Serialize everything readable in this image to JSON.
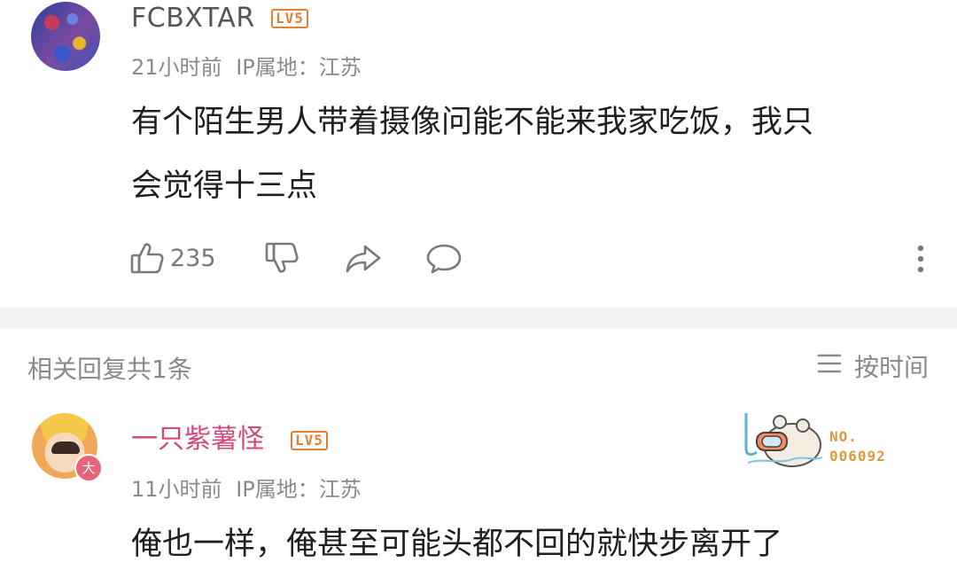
{
  "comment": {
    "username": "FCBXTAR",
    "level": "LV5",
    "time": "21小时前",
    "ip_location": "IP属地：江苏",
    "text_line1": "有个陌生男人带着摄像问能不能来我家吃饭，我只",
    "text_line2": "会觉得十三点",
    "like_count": "235",
    "icons": [
      "thumbs-up-icon",
      "thumbs-down-icon",
      "share-icon",
      "comment-icon",
      "more-vertical-icon"
    ]
  },
  "replies": {
    "count_label": "相关回复共1条",
    "sort_label": "按时间",
    "sort_icon": "menu-lines-icon"
  },
  "reply": {
    "username": "一只紫薯怪",
    "level": "LV5",
    "vip_badge": "大",
    "time": "11小时前",
    "ip_location": "IP属地：江苏",
    "text": "俺也一样，俺甚至可能头都不回的就快步离开了",
    "medal_line1": "NO.",
    "medal_line2": "006092"
  },
  "colors": {
    "username_reply": "#d2497a",
    "level_badge": "#e37e33",
    "meta_gray": "#8a8a8a",
    "divider": "#f2f2f2"
  }
}
